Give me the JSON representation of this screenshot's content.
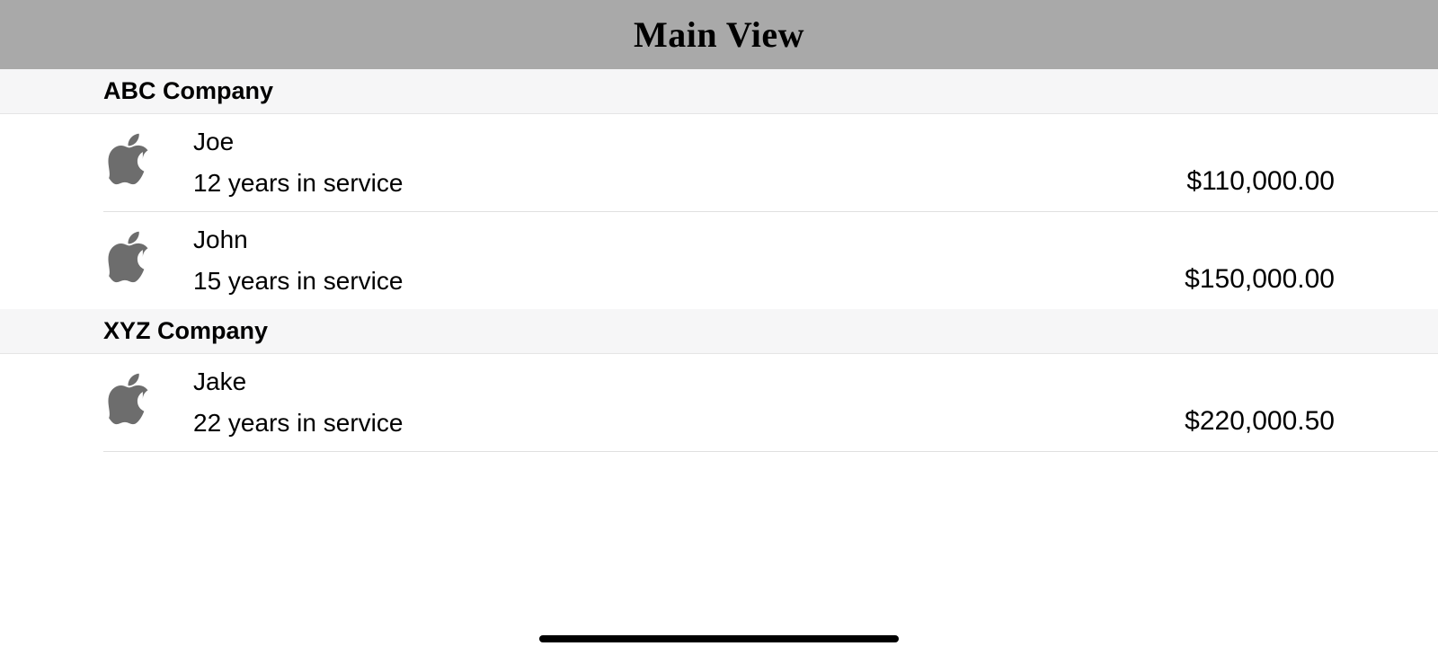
{
  "header": {
    "title": "Main View"
  },
  "sections": [
    {
      "title": "ABC Company",
      "rows": [
        {
          "icon": "apple-logo-icon",
          "name": "Joe",
          "subtitle": "12 years in service",
          "amount": "$110,000.00"
        },
        {
          "icon": "apple-logo-icon",
          "name": "John",
          "subtitle": "15 years in service",
          "amount": "$150,000.00"
        }
      ]
    },
    {
      "title": "XYZ Company",
      "rows": [
        {
          "icon": "apple-logo-icon",
          "name": "Jake",
          "subtitle": "22 years in service",
          "amount": "$220,000.50"
        }
      ]
    }
  ]
}
